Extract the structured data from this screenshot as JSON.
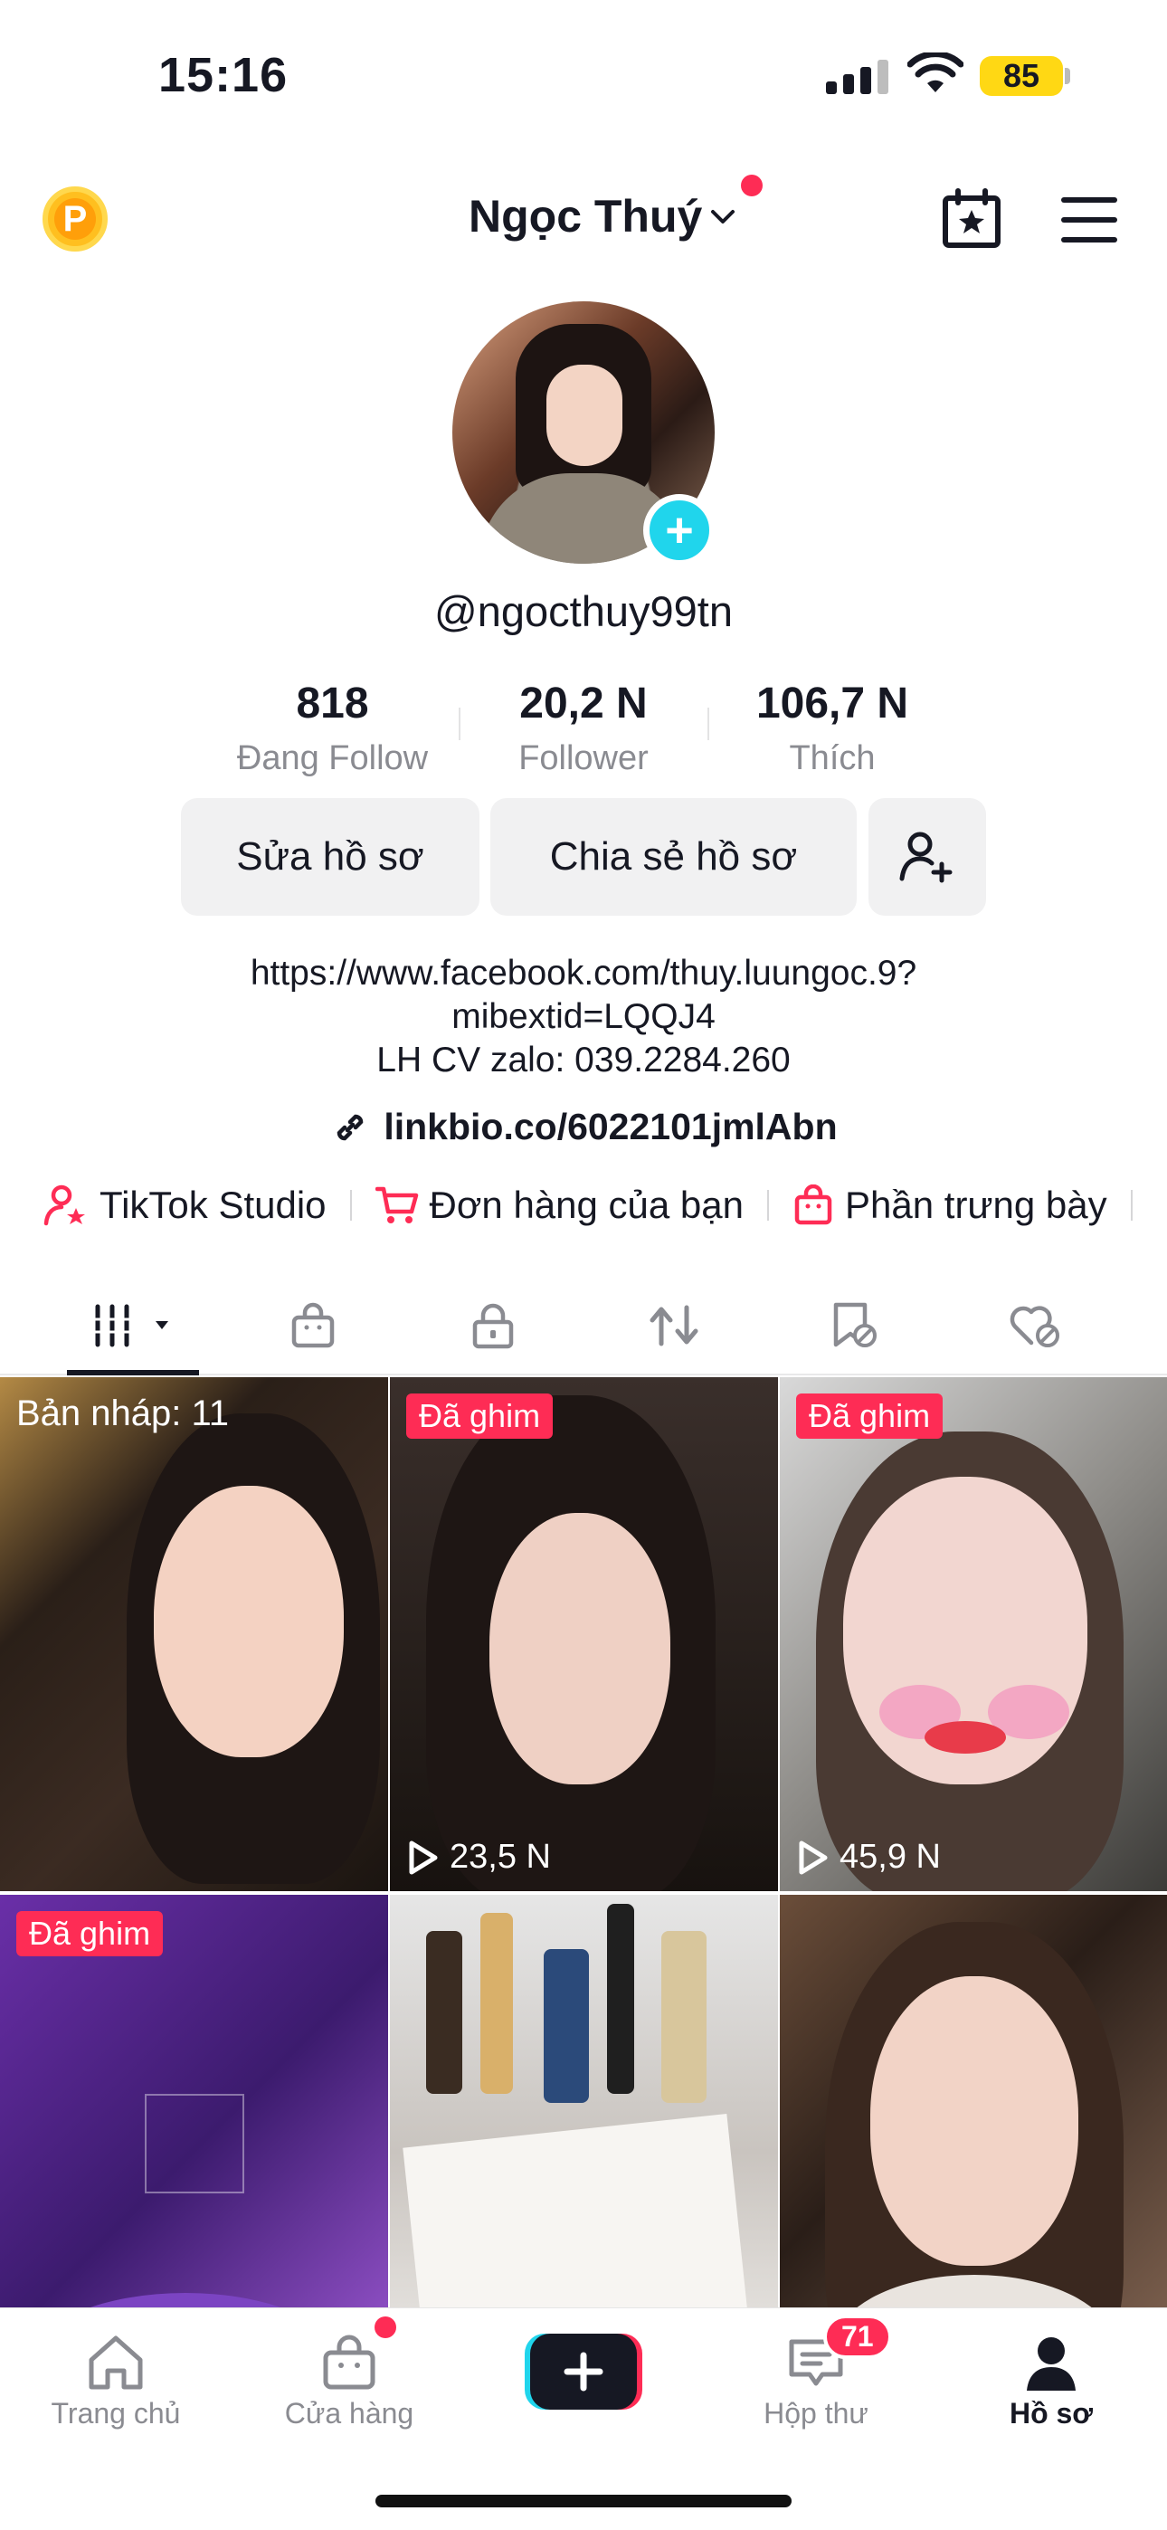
{
  "status_bar": {
    "time": "15:16",
    "battery": "85"
  },
  "header": {
    "username": "Ngọc Thuý"
  },
  "profile": {
    "handle": "@ngocthuy99tn",
    "stats": [
      {
        "value": "818",
        "label": "Đang Follow"
      },
      {
        "value": "20,2 N",
        "label": "Follower"
      },
      {
        "value": "106,7 N",
        "label": "Thích"
      }
    ],
    "edit_label": "Sửa hồ sơ",
    "share_label": "Chia sẻ hồ sơ",
    "bio_line1": "https://www.facebook.com/thuy.luungoc.9?",
    "bio_line2": "mibextid=LQQJ4",
    "bio_line3": "LH CV zalo: 039.2284.260",
    "link": "linkbio.co/6022101jmlAbn"
  },
  "quick_links": {
    "studio": "TikTok Studio",
    "orders": "Đơn hàng của bạn",
    "showcase": "Phần trưng bày"
  },
  "grid": {
    "draft_label": "Bản nháp: 11",
    "pinned_label": "Đã ghim",
    "views_2": "23,5 N",
    "views_3": "45,9 N"
  },
  "nav": {
    "home": "Trang chủ",
    "shop": "Cửa hàng",
    "inbox": "Hộp thư",
    "inbox_badge": "71",
    "profile": "Hồ sơ"
  },
  "colors": {
    "accent": "#fe2c55",
    "plus": "#20d5ec",
    "battery": "#ffd814"
  }
}
